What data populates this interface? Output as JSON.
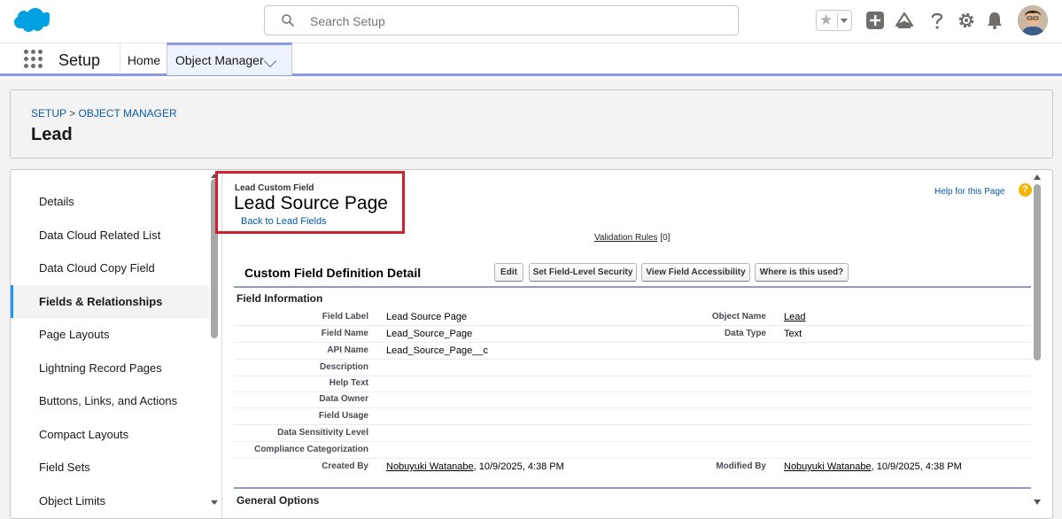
{
  "header": {
    "search_placeholder": "Search Setup"
  },
  "nav": {
    "app_name": "Setup",
    "home_label": "Home",
    "object_manager_label": "Object Manager"
  },
  "breadcrumb": {
    "setup": "SETUP",
    "separator": ">",
    "object_manager": "OBJECT MANAGER"
  },
  "object_title": "Lead",
  "sidebar": {
    "items": [
      {
        "label": "Details",
        "active": false
      },
      {
        "label": "Data Cloud Related List",
        "active": false
      },
      {
        "label": "Data Cloud Copy Field",
        "active": false
      },
      {
        "label": "Fields & Relationships",
        "active": true
      },
      {
        "label": "Page Layouts",
        "active": false
      },
      {
        "label": "Lightning Record Pages",
        "active": false
      },
      {
        "label": "Buttons, Links, and Actions",
        "active": false
      },
      {
        "label": "Compact Layouts",
        "active": false
      },
      {
        "label": "Field Sets",
        "active": false
      },
      {
        "label": "Object Limits",
        "active": false
      }
    ]
  },
  "field_page": {
    "subtitle": "Lead Custom Field",
    "title": "Lead Source Page",
    "back_link": "Back to Lead Fields",
    "help_link": "Help for this Page",
    "validation_rules_label": "Validation Rules",
    "validation_rules_count": "[0]",
    "detail_title": "Custom Field Definition Detail",
    "buttons": {
      "edit": "Edit",
      "set_fls": "Set Field-Level Security",
      "view_access": "View Field Accessibility",
      "where_used": "Where is this used?"
    },
    "section_field_info": "Field Information",
    "section_general": "General Options",
    "rows": [
      {
        "label": "Field Label",
        "value": "Lead Source Page",
        "label2": "Object Name",
        "value2": "Lead"
      },
      {
        "label": "Field Name",
        "value": "Lead_Source_Page",
        "label2": "Data Type",
        "value2": "Text"
      },
      {
        "label": "API Name",
        "value": "Lead_Source_Page__c",
        "label2": "",
        "value2": ""
      },
      {
        "label": "Description",
        "value": "",
        "label2": "",
        "value2": ""
      },
      {
        "label": "Help Text",
        "value": "",
        "label2": "",
        "value2": ""
      },
      {
        "label": "Data Owner",
        "value": "",
        "label2": "",
        "value2": ""
      },
      {
        "label": "Field Usage",
        "value": "",
        "label2": "",
        "value2": ""
      },
      {
        "label": "Data Sensitivity Level",
        "value": "",
        "label2": "",
        "value2": ""
      },
      {
        "label": "Compliance Categorization",
        "value": "",
        "label2": "",
        "value2": ""
      }
    ],
    "created_by": {
      "label": "Created By",
      "user": "Nobuyuki Watanabe",
      "date": ", 10/9/2025, 4:38 PM"
    },
    "modified_by": {
      "label": "Modified By",
      "user": "Nobuyuki Watanabe",
      "date": ", 10/9/2025, 4:38 PM"
    }
  },
  "colors": {
    "brand_blue": "#00a1e0",
    "link_blue": "#0b5cab",
    "highlight_red": "#d0202d",
    "nav_accent": "#8a97e5"
  },
  "icons": [
    "salesforce-cloud-logo",
    "search-icon",
    "star-icon",
    "add-icon",
    "trailhead-icon",
    "help-icon",
    "gear-icon",
    "bell-icon",
    "app-launcher-icon"
  ]
}
